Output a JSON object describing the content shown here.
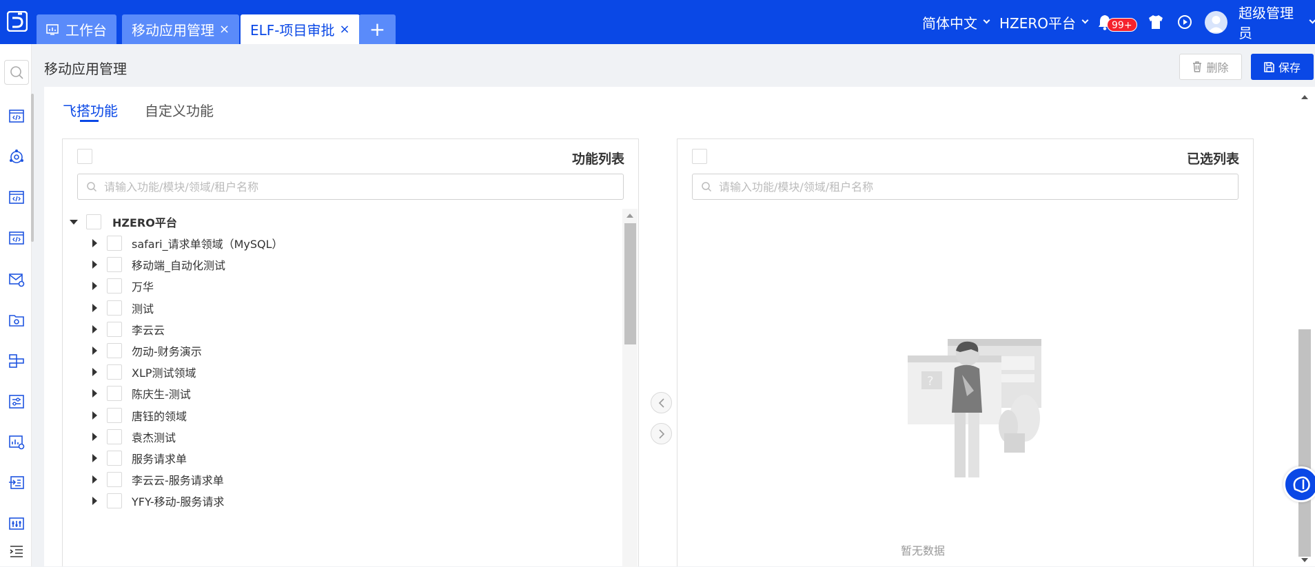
{
  "topbar": {
    "tabs": [
      {
        "label": "工作台",
        "closable": false,
        "active": false
      },
      {
        "label": "移动应用管理",
        "closable": true,
        "active": false
      },
      {
        "label": "ELF-项目审批",
        "closable": true,
        "active": true
      }
    ],
    "close_glyph": "×",
    "add_glyph": "+",
    "language": "简体中文",
    "platform": "HZERO平台",
    "notification_count": "99+",
    "user_name": "超级管理员"
  },
  "page": {
    "title": "移动应用管理",
    "delete_label": "删除",
    "save_label": "保存"
  },
  "subtabs": [
    "飞搭功能",
    "自定义功能"
  ],
  "left_panel": {
    "title": "功能列表",
    "search_placeholder": "请输入功能/模块/领域/租户名称",
    "tree": {
      "root": "HZERO平台",
      "children": [
        "safari_请求单领域（MySQL）",
        "移动端_自动化测试",
        "万华",
        "测试",
        "李云云",
        "勿动-财务演示",
        "XLP测试领域",
        "陈庆生-测试",
        "唐钰的领域",
        "袁杰测试",
        "服务请求单",
        "李云云-服务请求单",
        "YFY-移动-服务请求"
      ]
    }
  },
  "right_panel": {
    "title": "已选列表",
    "search_placeholder": "请输入功能/模块/领域/租户名称",
    "empty_text": "暂无数据"
  },
  "colors": {
    "brand": "#0a48e6",
    "tab_inactive": "#5a8bfa",
    "badge": "#f5222d"
  },
  "icons": [
    "logo-icon",
    "dashboard-icon",
    "bell-icon",
    "shirt-icon",
    "play-circle-icon",
    "search-icon",
    "trash-icon",
    "save-icon"
  ]
}
